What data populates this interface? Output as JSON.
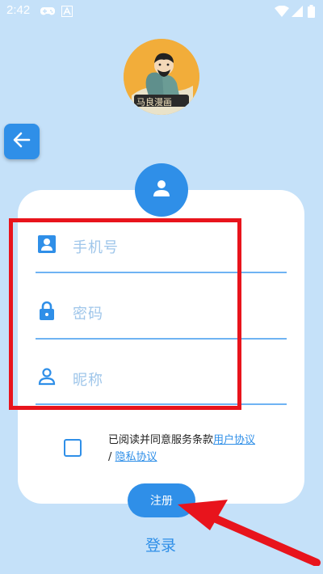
{
  "status_bar": {
    "time": "2:42"
  },
  "logo": {
    "text": "马良漫画"
  },
  "form": {
    "phone_placeholder": "手机号",
    "password_placeholder": "密码",
    "nickname_placeholder": "昵称"
  },
  "agreement": {
    "prefix": "已阅读并同意服务条款",
    "user_agreement": "用户协议",
    "separator": "/",
    "privacy_policy": "隐私协议",
    "checked": false
  },
  "buttons": {
    "register": "注册",
    "login": "登录"
  },
  "colors": {
    "background": "#c5e1f9",
    "accent": "#2f8fe8",
    "highlight": "#e8141c"
  }
}
